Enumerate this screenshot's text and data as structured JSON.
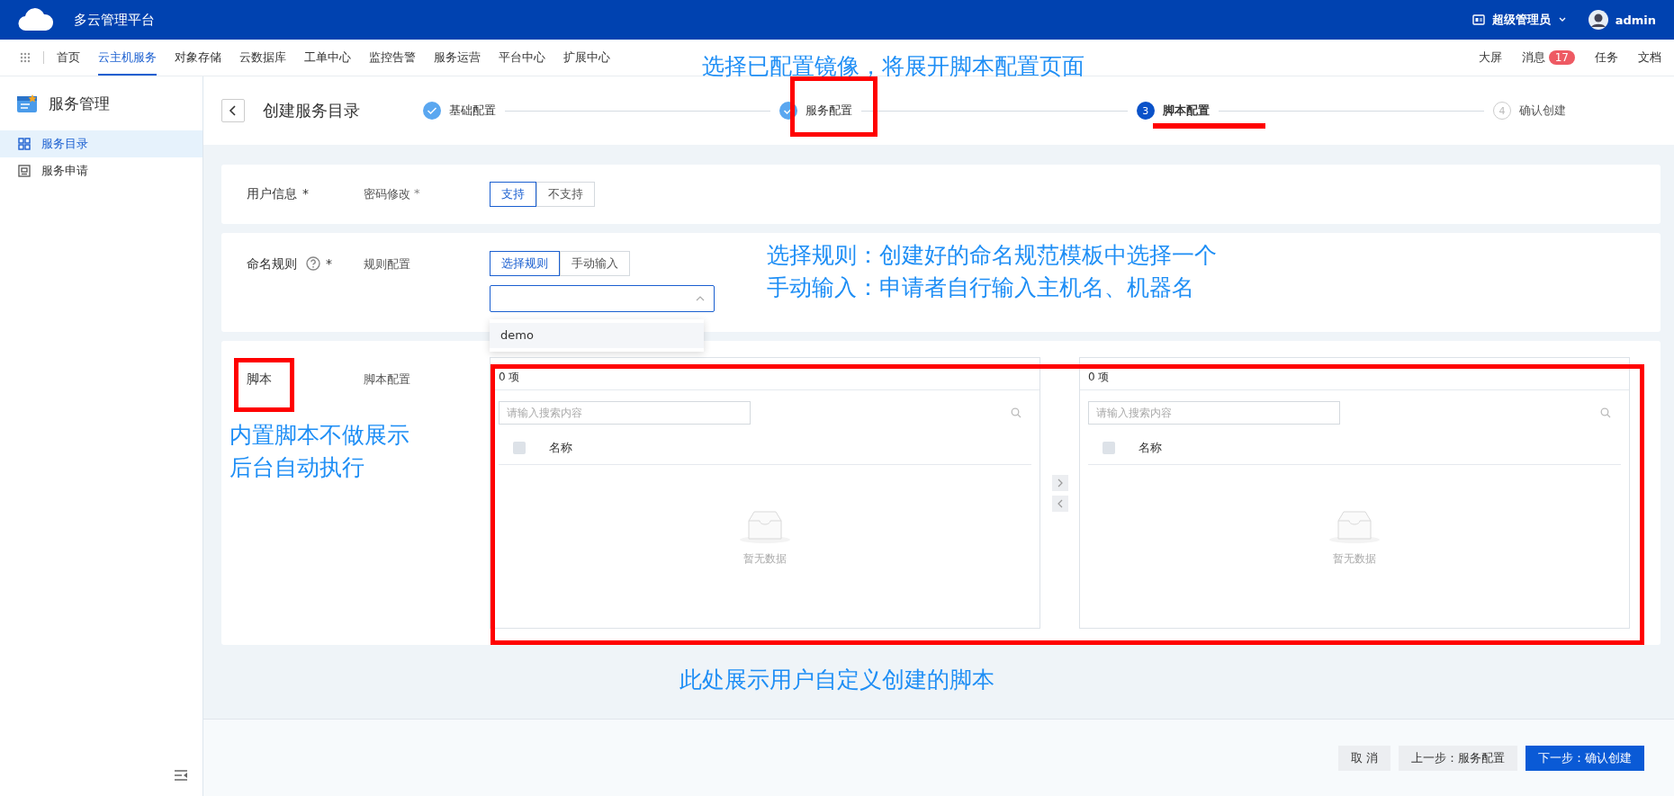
{
  "topbar": {
    "title": "多云管理平台",
    "role": "超级管理员",
    "user": "admin"
  },
  "nav": {
    "items": [
      {
        "label": "首页",
        "selected": false
      },
      {
        "label": "云主机服务",
        "selected": true
      },
      {
        "label": "对象存储",
        "selected": false
      },
      {
        "label": "云数据库",
        "selected": false
      },
      {
        "label": "工单中心",
        "selected": false
      },
      {
        "label": "监控告警",
        "selected": false
      },
      {
        "label": "服务运营",
        "selected": false
      },
      {
        "label": "平台中心",
        "selected": false
      },
      {
        "label": "扩展中心",
        "selected": false
      }
    ],
    "right": [
      {
        "label": "大屏"
      },
      {
        "label": "消息",
        "badge": "17"
      },
      {
        "label": "任务"
      },
      {
        "label": "文档"
      }
    ]
  },
  "sidebar": {
    "title": "服务管理",
    "items": [
      {
        "label": "服务目录",
        "selected": true,
        "kind": "grid"
      },
      {
        "label": "服务申请",
        "kind": "form",
        "selected": false
      }
    ]
  },
  "page": {
    "title": "创建服务目录",
    "steps": [
      {
        "label": "基础配置",
        "done": true,
        "current": false
      },
      {
        "label": "服务配置",
        "done": true,
        "current": false
      },
      {
        "label": "脚本配置",
        "done": false,
        "current": true,
        "number": "3"
      },
      {
        "label": "确认创建",
        "done": false,
        "current": false,
        "number": "4"
      }
    ]
  },
  "sections": [
    {
      "kind": "toggle",
      "label": "用户信息",
      "required_mark": "*",
      "field_label": "密码修改",
      "field_required_mark": "*",
      "options": [
        {
          "label": "支持",
          "selected": true
        },
        {
          "label": "不支持",
          "selected": false
        }
      ]
    },
    {
      "kind": "select",
      "label": "命名规则",
      "help": true,
      "required_mark": "*",
      "field_label": "规则配置",
      "options": [
        {
          "label": "选择规则",
          "selected": true
        },
        {
          "label": "手动输入",
          "selected": false
        }
      ],
      "dropdown": {
        "open": true,
        "items": [
          "demo"
        ]
      }
    },
    {
      "kind": "transfer",
      "label": "脚本",
      "field_label": "脚本配置",
      "panels": [
        {
          "count": "0 项",
          "placeholder": "请输入搜索内容",
          "column": "名称",
          "checked": false,
          "empty": "暂无数据"
        },
        {
          "count": "0 项",
          "placeholder": "请输入搜索内容",
          "column": "名称",
          "checked": false,
          "empty": "暂无数据"
        }
      ]
    }
  ],
  "footer": {
    "buttons": [
      {
        "label": "取 消",
        "kind": "default"
      },
      {
        "label": "上一步：服务配置",
        "kind": "default"
      },
      {
        "label": "下一步：确认创建",
        "kind": "primary"
      }
    ]
  },
  "annotations": [
    {
      "lines": [
        "选择已配置镜像，将展开脚本配置页面"
      ]
    },
    {
      "lines": [
        "选择规则：创建好的命名规范模板中选择一个",
        "手动输入：申请者自行输入主机名、机器名"
      ]
    },
    {
      "lines": [
        "内置脚本不做展示",
        "后台自动执行"
      ]
    },
    {
      "lines": [
        "此处展示用户自定义创建的脚本"
      ]
    }
  ]
}
